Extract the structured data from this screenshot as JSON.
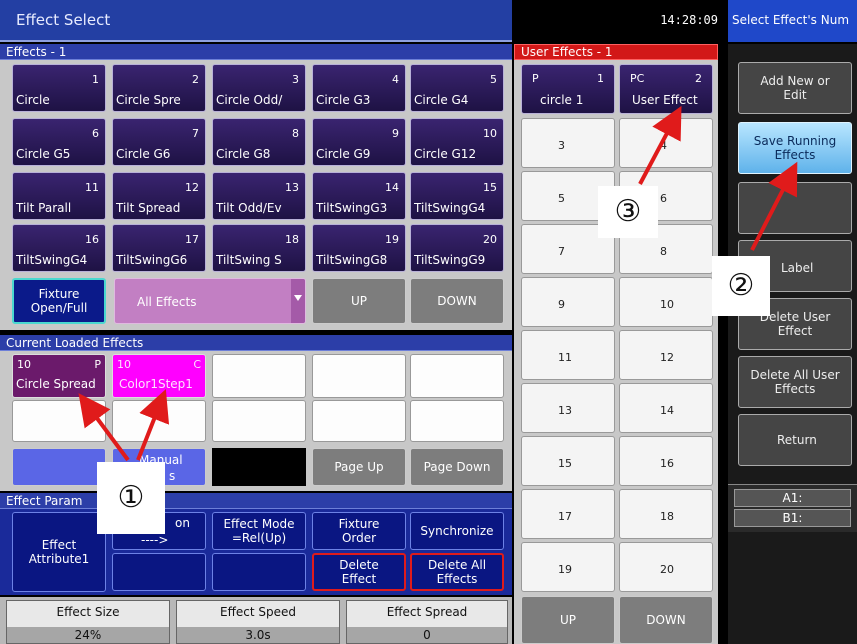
{
  "header": {
    "title": "Effect Select",
    "clock": "14:28:09",
    "prompt": "Select Effect's Num"
  },
  "effects": {
    "header": "Effects - 1",
    "buttons": [
      {
        "num": "1",
        "name": "Circle"
      },
      {
        "num": "2",
        "name": "Circle Spre"
      },
      {
        "num": "3",
        "name": "Circle Odd/"
      },
      {
        "num": "4",
        "name": "Circle G3"
      },
      {
        "num": "5",
        "name": "Circle G4"
      },
      {
        "num": "6",
        "name": "Circle G5"
      },
      {
        "num": "7",
        "name": "Circle G6"
      },
      {
        "num": "8",
        "name": "Circle G8"
      },
      {
        "num": "9",
        "name": "Circle G9"
      },
      {
        "num": "10",
        "name": "Circle G12"
      },
      {
        "num": "11",
        "name": "Tilt Parall"
      },
      {
        "num": "12",
        "name": "Tilt Spread"
      },
      {
        "num": "13",
        "name": "Tilt Odd/Ev"
      },
      {
        "num": "14",
        "name": "TiltSwingG3"
      },
      {
        "num": "15",
        "name": "TiltSwingG4"
      },
      {
        "num": "16",
        "name": "TiltSwingG4"
      },
      {
        "num": "17",
        "name": "TiltSwingG6"
      },
      {
        "num": "18",
        "name": "TiltSwing S"
      },
      {
        "num": "19",
        "name": "TiltSwingG8"
      },
      {
        "num": "20",
        "name": "TiltSwingG9"
      }
    ],
    "fixture_label": "Fixture Open/Full",
    "filter_value": "All Effects",
    "up_label": "UP",
    "down_label": "DOWN"
  },
  "loaded": {
    "header": "Current Loaded Effects",
    "slot1": {
      "num": "10",
      "tag": "P",
      "name": "Circle Spread"
    },
    "slot2": {
      "num": "10",
      "tag": "C",
      "name": "Color1Step1"
    },
    "manual_label": "Manual",
    "manual_suffix": "s",
    "page_up": "Page Up",
    "page_down": "Page Down"
  },
  "params": {
    "header": "Effect Param",
    "attribute": "Effect Attribute1",
    "direction_top": "on",
    "direction_bottom": "---->",
    "mode": "Effect Mode =Rel(Up)",
    "fixture_order": "Fixture Order",
    "synchronize": "Synchronize",
    "delete_effect": "Delete Effect",
    "delete_all_effects": "Delete All Effects"
  },
  "status": {
    "size_label": "Effect Size",
    "size_value": "24%",
    "speed_label": "Effect Speed",
    "speed_value": "3.0s",
    "spread_label": "Effect Spread",
    "spread_value": "0"
  },
  "user_effects": {
    "header": "User Effects - 1",
    "first": {
      "tag": "P",
      "num": "1",
      "name": "circle 1"
    },
    "second": {
      "tag": "PC",
      "num": "2",
      "name": "User Effect"
    },
    "numbers": [
      "3",
      "4",
      "5",
      "6",
      "7",
      "8",
      "9",
      "10",
      "11",
      "12",
      "13",
      "14",
      "15",
      "16",
      "17",
      "18",
      "19",
      "20"
    ],
    "up_label": "UP",
    "down_label": "DOWN"
  },
  "side": {
    "add_new": "Add New or Edit",
    "save_running": "Save Running Effects",
    "label": "Label",
    "delete_user": "Delete User Effect",
    "delete_all_user": "Delete All User Effects",
    "return": "Return",
    "a1": "A1:",
    "b1": "B1:"
  },
  "annotations": [
    "①",
    "②",
    "③"
  ],
  "colors": {
    "title_blue": "#233fa3",
    "accent_red": "#e01b1b",
    "magenta": "#ff00ff",
    "save_highlight": "#8fd0ff"
  }
}
